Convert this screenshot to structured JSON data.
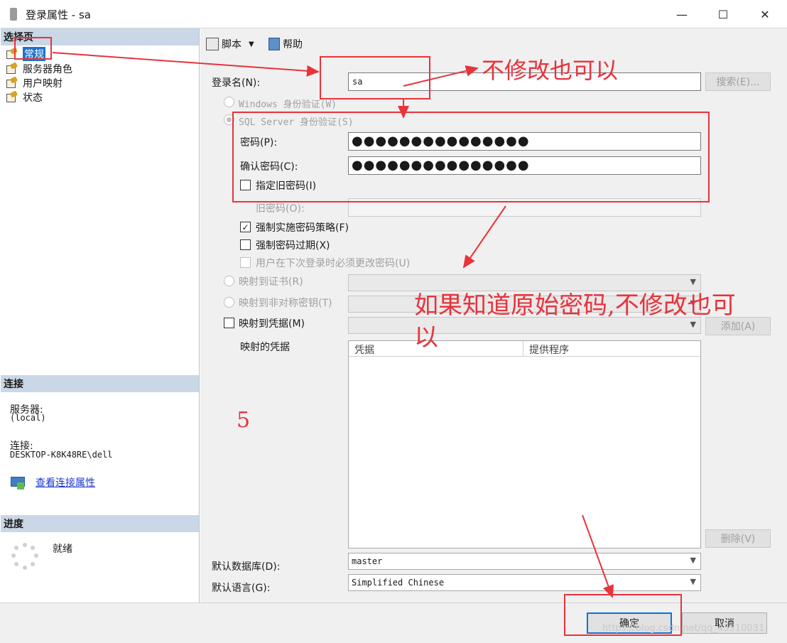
{
  "window": {
    "title": "登录属性 - sa",
    "controls": {
      "minimize": "—",
      "maximize": "☐",
      "close": "✕"
    }
  },
  "left_panel": {
    "select_page_header": "选择页",
    "pages": [
      {
        "label": "常规",
        "selected": true
      },
      {
        "label": "服务器角色",
        "selected": false
      },
      {
        "label": "用户映射",
        "selected": false
      },
      {
        "label": "状态",
        "selected": false
      }
    ],
    "connection_header": "连接",
    "server_label": "服务器:",
    "server_value": "(local)",
    "connection_label": "连接:",
    "connection_value": "DESKTOP-K8K48RE\\dell",
    "view_connection_link": "查看连接属性",
    "progress_header": "进度",
    "progress_status": "就绪"
  },
  "toolbar": {
    "script_label": "脚本",
    "help_label": "帮助"
  },
  "form": {
    "login_name_label": "登录名(N):",
    "login_name_value": "sa",
    "search_button": "搜索(E)...",
    "windows_auth_label": "Windows 身份验证(W)",
    "sql_auth_label": "SQL Server 身份验证(S)",
    "password_label": "密码(P):",
    "password_value": "●●●●●●●●●●●●●●●",
    "confirm_password_label": "确认密码(C):",
    "confirm_password_value": "●●●●●●●●●●●●●●●",
    "specify_old_password_label": "指定旧密码(I)",
    "old_password_label": "旧密码(O):",
    "enforce_policy_label": "强制实施密码策略(F)",
    "enforce_expiration_label": "强制密码过期(X)",
    "must_change_label": "用户在下次登录时必须更改密码(U)",
    "map_certificate_label": "映射到证书(R)",
    "map_asymmetric_key_label": "映射到非对称密钥(T)",
    "map_credential_label": "映射到凭据(M)",
    "add_button": "添加(A)",
    "mapped_credentials_label": "映射的凭据",
    "grid_columns": [
      "凭据",
      "提供程序"
    ],
    "remove_button": "删除(V)",
    "default_database_label": "默认数据库(D):",
    "default_database_value": "master",
    "default_language_label": "默认语言(G):",
    "default_language_value": "Simplified Chinese"
  },
  "footer": {
    "ok_button": "确定",
    "cancel_button": "取消",
    "watermark": "https://blog.csdn.net/qq_43510031"
  },
  "annotations": {
    "note1": "不修改也可以",
    "note2_line1": "如果知道原始密码,不修改也可",
    "note2_line2": "以",
    "step_number": "5"
  },
  "colors": {
    "annotation_red": "#e8333c",
    "selection_blue": "#1e73c8",
    "header_blue": "#c9d7e6"
  }
}
